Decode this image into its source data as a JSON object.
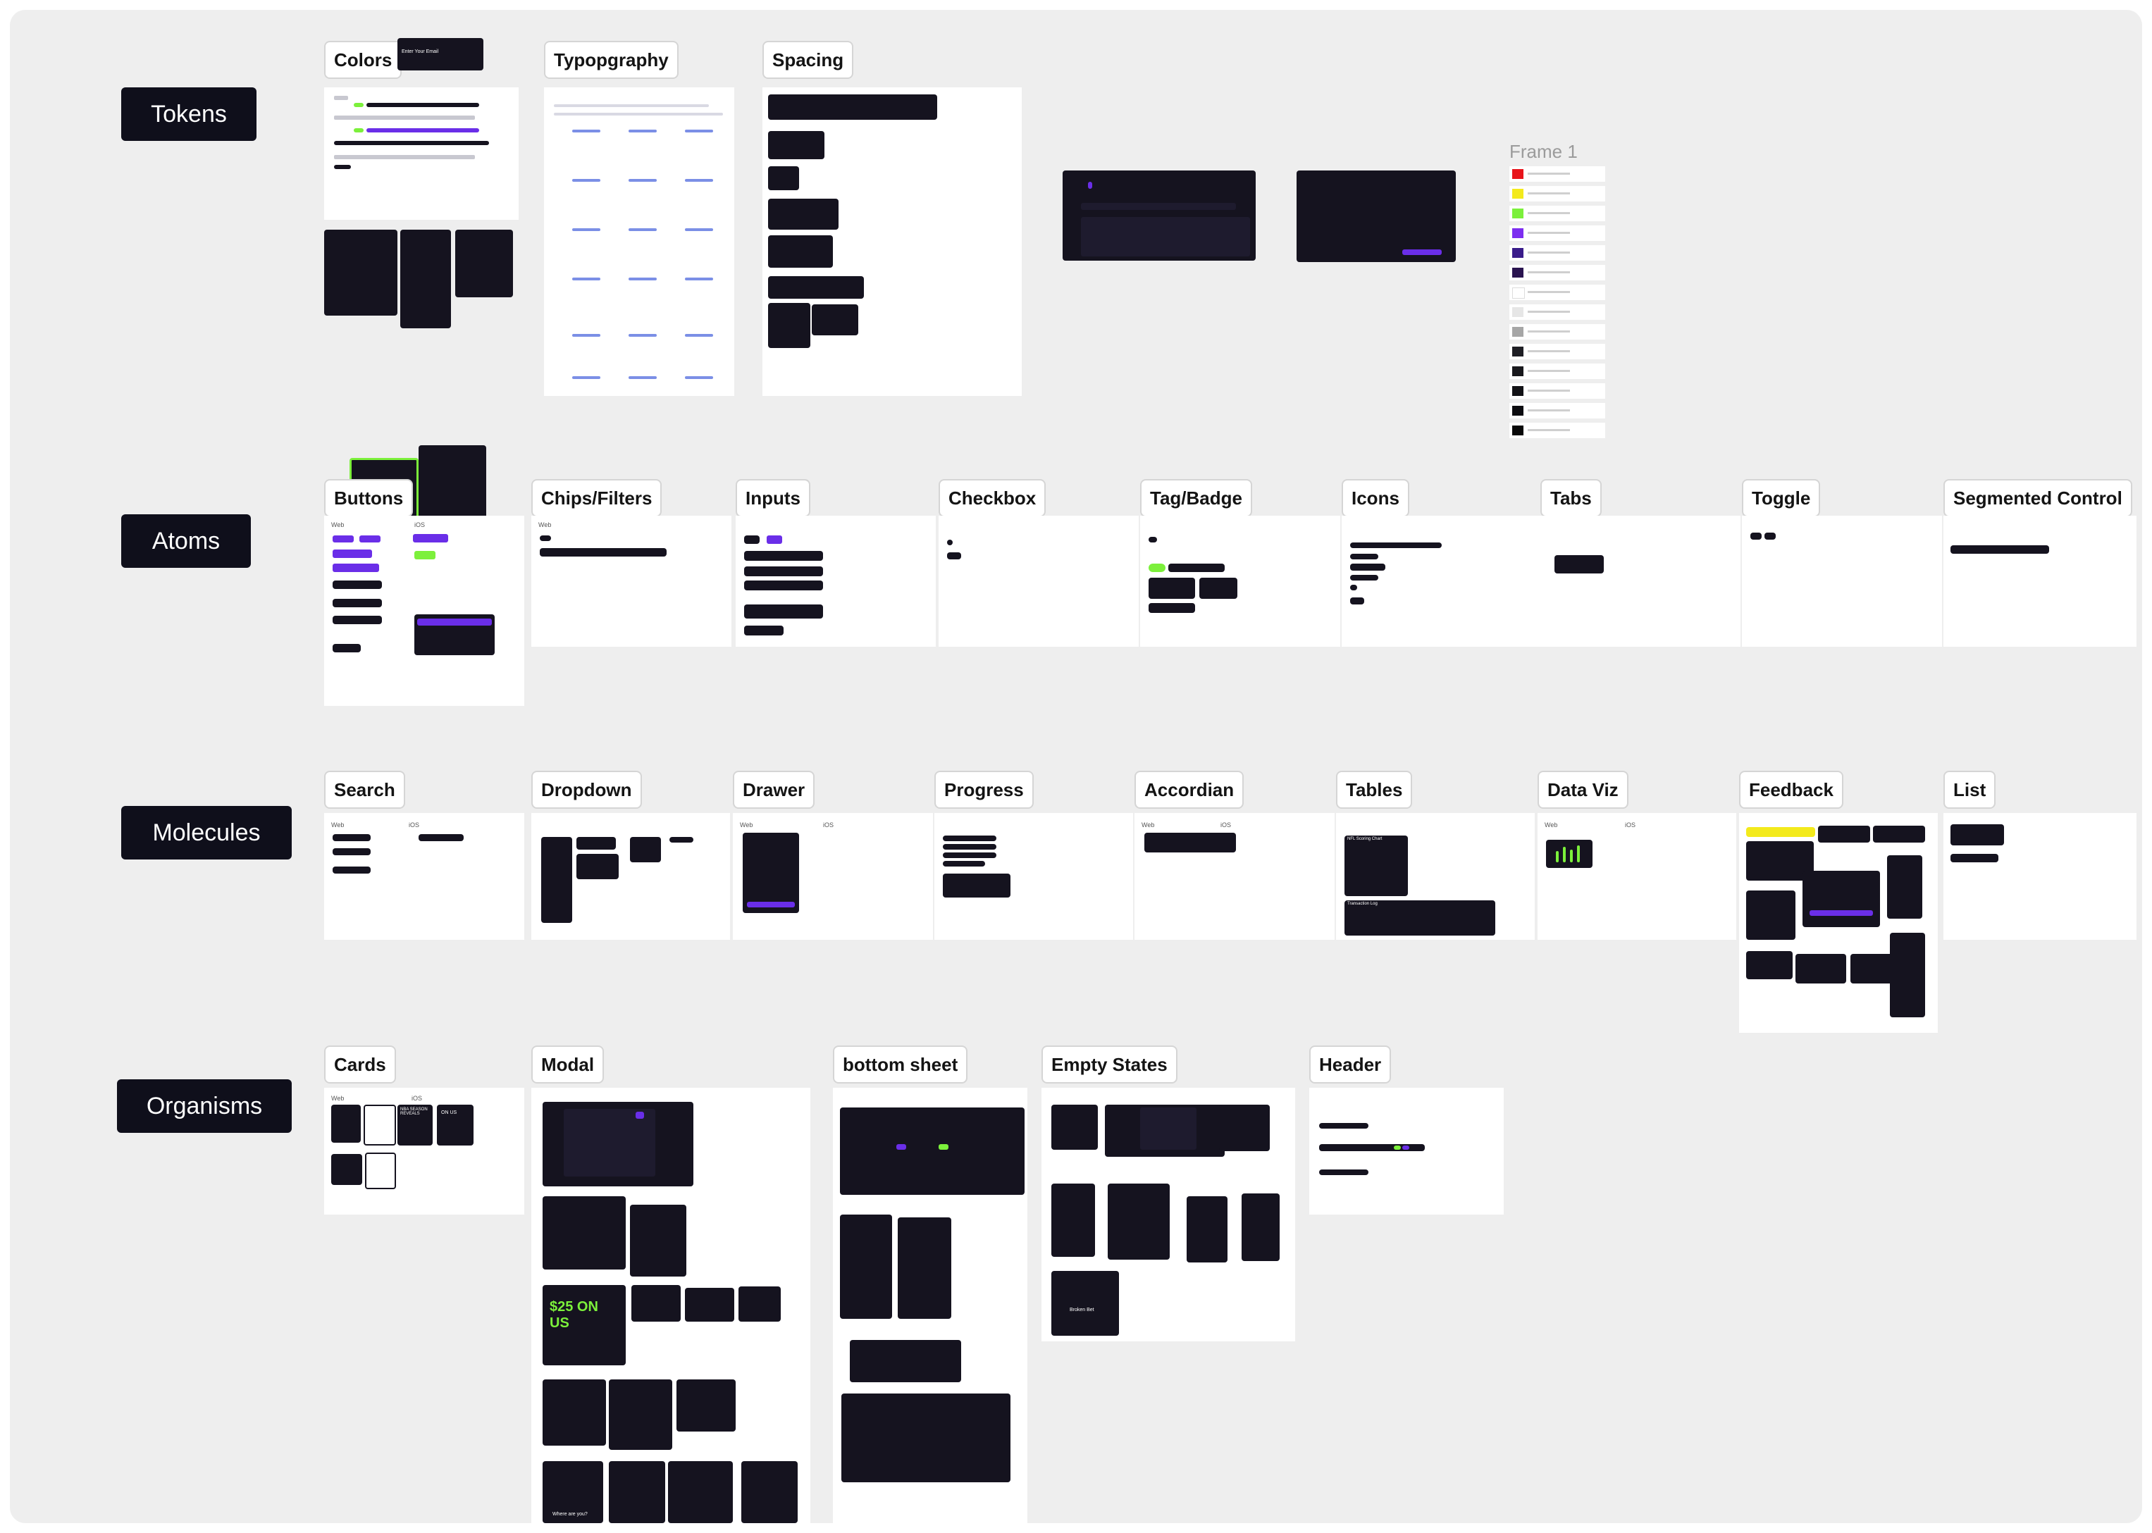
{
  "sections": {
    "tokens": "Tokens",
    "atoms": "Atoms",
    "molecules": "Molecules",
    "organisms": "Organisms"
  },
  "frames": {
    "colors": "Colors",
    "typography": "Typopgraphy",
    "spacing": "Spacing",
    "buttons": "Buttons",
    "chips": "Chips/Filters",
    "inputs": "Inputs",
    "checkbox": "Checkbox",
    "tag": "Tag/Badge",
    "icons": "Icons",
    "tabs": "Tabs",
    "toggle": "Toggle",
    "segmented": "Segmented Control",
    "search": "Search",
    "dropdown": "Dropdown",
    "drawer": "Drawer",
    "progress": "Progress",
    "accordian": "Accordian",
    "tables": "Tables",
    "dataviz": "Data Viz",
    "feedback": "Feedback",
    "list": "List",
    "cards": "Cards",
    "modal": "Modal",
    "bottom_sheet": "bottom sheet",
    "empty_states": "Empty States",
    "header": "Header"
  },
  "frame1": {
    "title": "Frame 1",
    "swatches": [
      "#e8141b",
      "#f3ea1c",
      "#7cf03b",
      "#7d2ef0",
      "#3a1c8a",
      "#2a1450",
      "#ffffff",
      "#e6e6e6",
      "#a6a6a6",
      "#1e1e24",
      "#18181c",
      "#121216",
      "#0c0c10",
      "#080808"
    ]
  },
  "mini": {
    "colors_mock_title": "Enter Your Email",
    "web": "Web",
    "ios": "iOS",
    "promo": "$25 ON US",
    "nba": "NBA SEASON REVEALS",
    "on_us": "ON US",
    "where_are_you": "Where are you?",
    "broken_bet": "Broken Bet",
    "nfl_scoring": "NFL Scoring Chart",
    "transaction_log": "Transaction Log"
  },
  "colors": {
    "background": "#eeeeee",
    "label_dark": "#0f0f1b",
    "ui_dark": "#15131f",
    "accent_purple": "#6a2ee8",
    "accent_green": "#7cf03b"
  }
}
